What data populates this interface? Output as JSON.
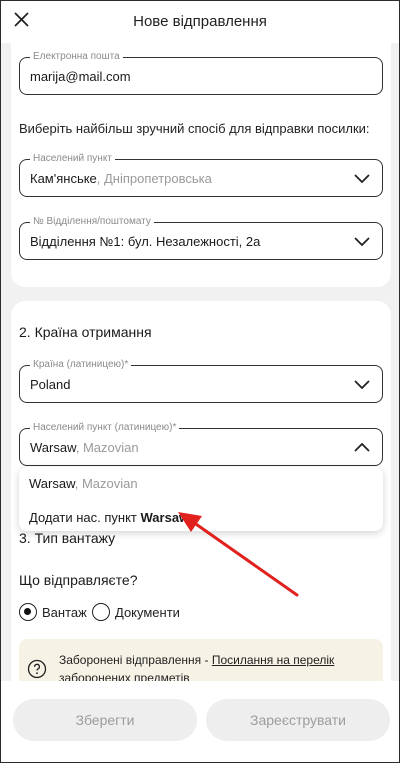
{
  "header": {
    "title": "Нове відправлення"
  },
  "email": {
    "legend": "Електронна пошта",
    "value": "marija@mail.com"
  },
  "delivery": {
    "prompt": "Виберіть найбільш зручний спосіб для відправки посилки:",
    "city": {
      "legend": "Населений пункт",
      "value": "Кам'янське",
      "region": ", Дніпропетровська"
    },
    "branch": {
      "legend": "№ Відділення/поштомату",
      "value": "Відділення №1: бул. Незалежності, 2а"
    }
  },
  "country_section": {
    "title": "2. Країна отримання",
    "country": {
      "legend": "Країна (латиницею)*",
      "value": "Poland"
    },
    "city": {
      "legend": "Населений пункт (латиницею)*",
      "value": "Warsaw",
      "region": ", Mazovian"
    },
    "dropdown": {
      "option1_city": "Warsaw",
      "option1_region": ", Mazovian",
      "option2_prefix": "Додати нас. пункт ",
      "option2_city": "Warsaw"
    }
  },
  "cargo_section": {
    "title": "3. Тип вантажу",
    "question": "Що відправляєте?",
    "options": [
      {
        "label": "Вантаж",
        "selected": true
      },
      {
        "label": "Документи",
        "selected": false
      }
    ]
  },
  "notice": {
    "text": "Заборонені відправлення - ",
    "link": "Посилання на перелік",
    "text2": "заборонених предметів"
  },
  "footer": {
    "save_label": "Зберегти",
    "register_label": "Зареєструвати"
  },
  "colors": {
    "annotation_arrow": "#e0211d",
    "notice_bg": "#f7f2e6",
    "disabled_button_bg": "#eeeeee"
  }
}
